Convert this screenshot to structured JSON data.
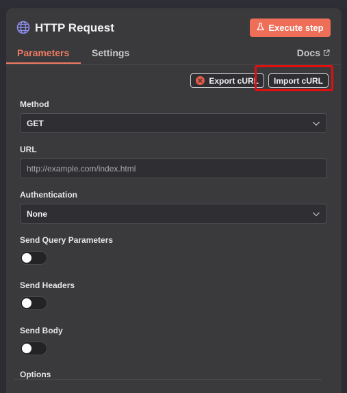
{
  "node": {
    "title": "HTTP Request",
    "execute_label": "Execute step"
  },
  "tabs": {
    "parameters": "Parameters",
    "settings": "Settings",
    "docs": "Docs"
  },
  "curl": {
    "export_label": "Export cURL",
    "import_label": "Import cURL"
  },
  "fields": {
    "method_label": "Method",
    "method_value": "GET",
    "url_label": "URL",
    "url_placeholder": "http://example.com/index.html",
    "auth_label": "Authentication",
    "auth_value": "None",
    "query_label": "Send Query Parameters",
    "headers_label": "Send Headers",
    "body_label": "Send Body",
    "options_label": "Options"
  },
  "colors": {
    "accent": "#ee6e58",
    "highlight": "#e01010"
  },
  "icons": [
    "globe-icon",
    "flask-icon",
    "external-link-icon",
    "export-icon",
    "chevron-down-icon"
  ]
}
